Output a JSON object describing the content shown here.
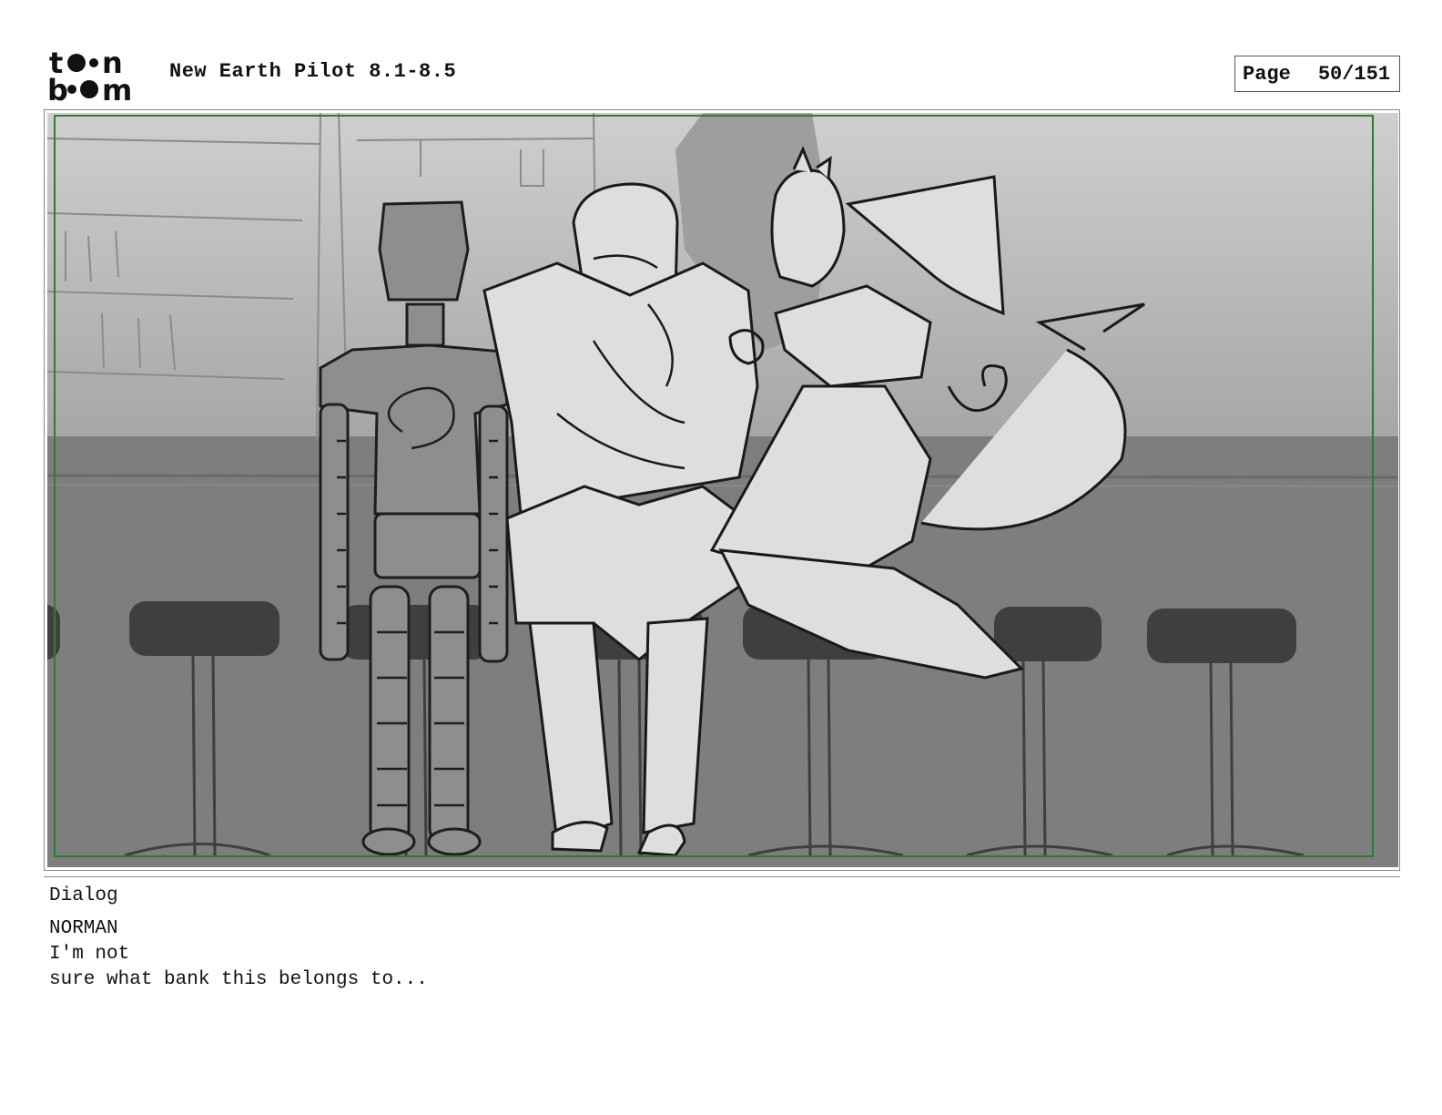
{
  "header": {
    "logo_top": "toon",
    "logo_bottom": "boom",
    "title": "New Earth Pilot 8.1-8.5",
    "page_label": "Page",
    "page_number": "50/151"
  },
  "panel": {
    "safe_frame_color": "#2e7d32",
    "background_color": "#c9c9c9",
    "floor_color": "#7e7e7e"
  },
  "dialog": {
    "label": "Dialog",
    "character": "NORMAN",
    "lines": [
      "I'm not",
      "sure what bank this belongs to..."
    ]
  }
}
